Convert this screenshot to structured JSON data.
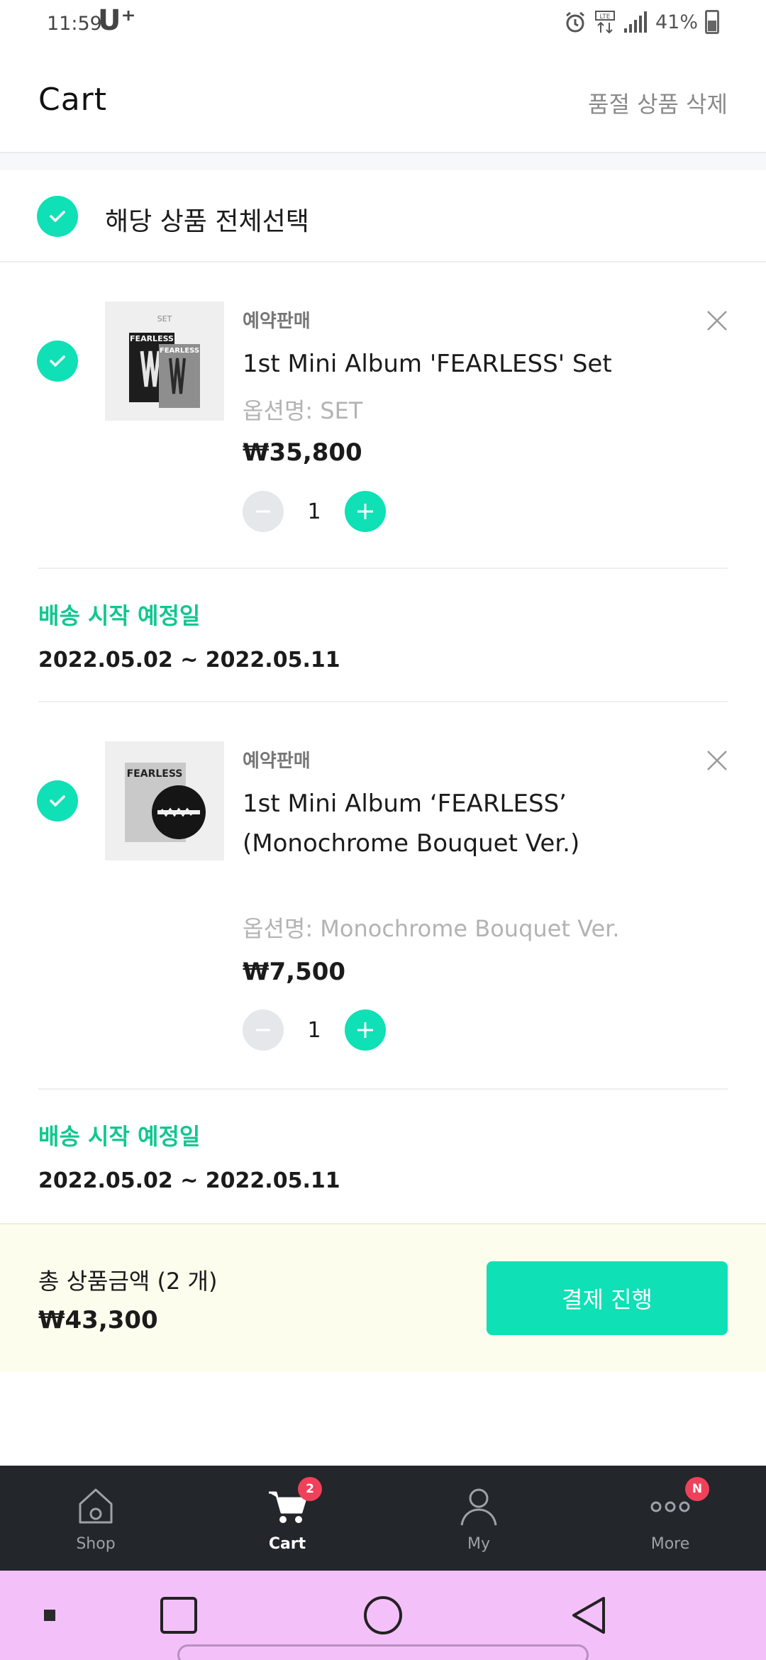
{
  "status_bar": {
    "time": "11:59",
    "carrier": "U⁺",
    "battery": "41%"
  },
  "header": {
    "title": "Cart",
    "action": "품절 상품 삭제"
  },
  "select_all": {
    "label": "해당 상품 전체선택",
    "checked": true
  },
  "items": [
    {
      "tag": "예약판매",
      "title": "1st Mini Album 'FEARLESS' Set",
      "option": "옵션명: SET",
      "price": "₩35,800",
      "qty": "1",
      "checked": true,
      "thumb": {
        "set_label": "SET",
        "cover_text": "FEARLESS"
      },
      "shipping": {
        "label": "배송 시작 예정일",
        "dates": "2022.05.02 ~ 2022.05.11"
      }
    },
    {
      "tag": "예약판매",
      "title": "1st Mini Album ‘FEARLESS’ (Monochrome Bouquet Ver.)",
      "option": "옵션명: Monochrome Bouquet Ver.",
      "price": "₩7,500",
      "qty": "1",
      "checked": true,
      "thumb": {
        "cover_text": "FEARLESS"
      },
      "shipping": {
        "label": "배송 시작 예정일",
        "dates": "2022.05.02 ~ 2022.05.11"
      }
    }
  ],
  "total": {
    "label": "총 상품금액 (2 개)",
    "value": "₩43,300",
    "checkout_label": "결제 진행"
  },
  "bottom_nav": [
    {
      "label": "Shop",
      "icon": "home-icon",
      "active": false
    },
    {
      "label": "Cart",
      "icon": "cart-icon",
      "active": true,
      "badge": "2"
    },
    {
      "label": "My",
      "icon": "person-icon",
      "active": false
    },
    {
      "label": "More",
      "icon": "more-icon",
      "active": false,
      "badge": "N"
    }
  ],
  "colors": {
    "accent": "#0fe0b6",
    "shipping_label": "#10c78f",
    "badge": "#f0415a",
    "nav_bg": "#23262b",
    "total_bg": "#fdfdee",
    "system_nav_bg": "#f4c0fa"
  }
}
